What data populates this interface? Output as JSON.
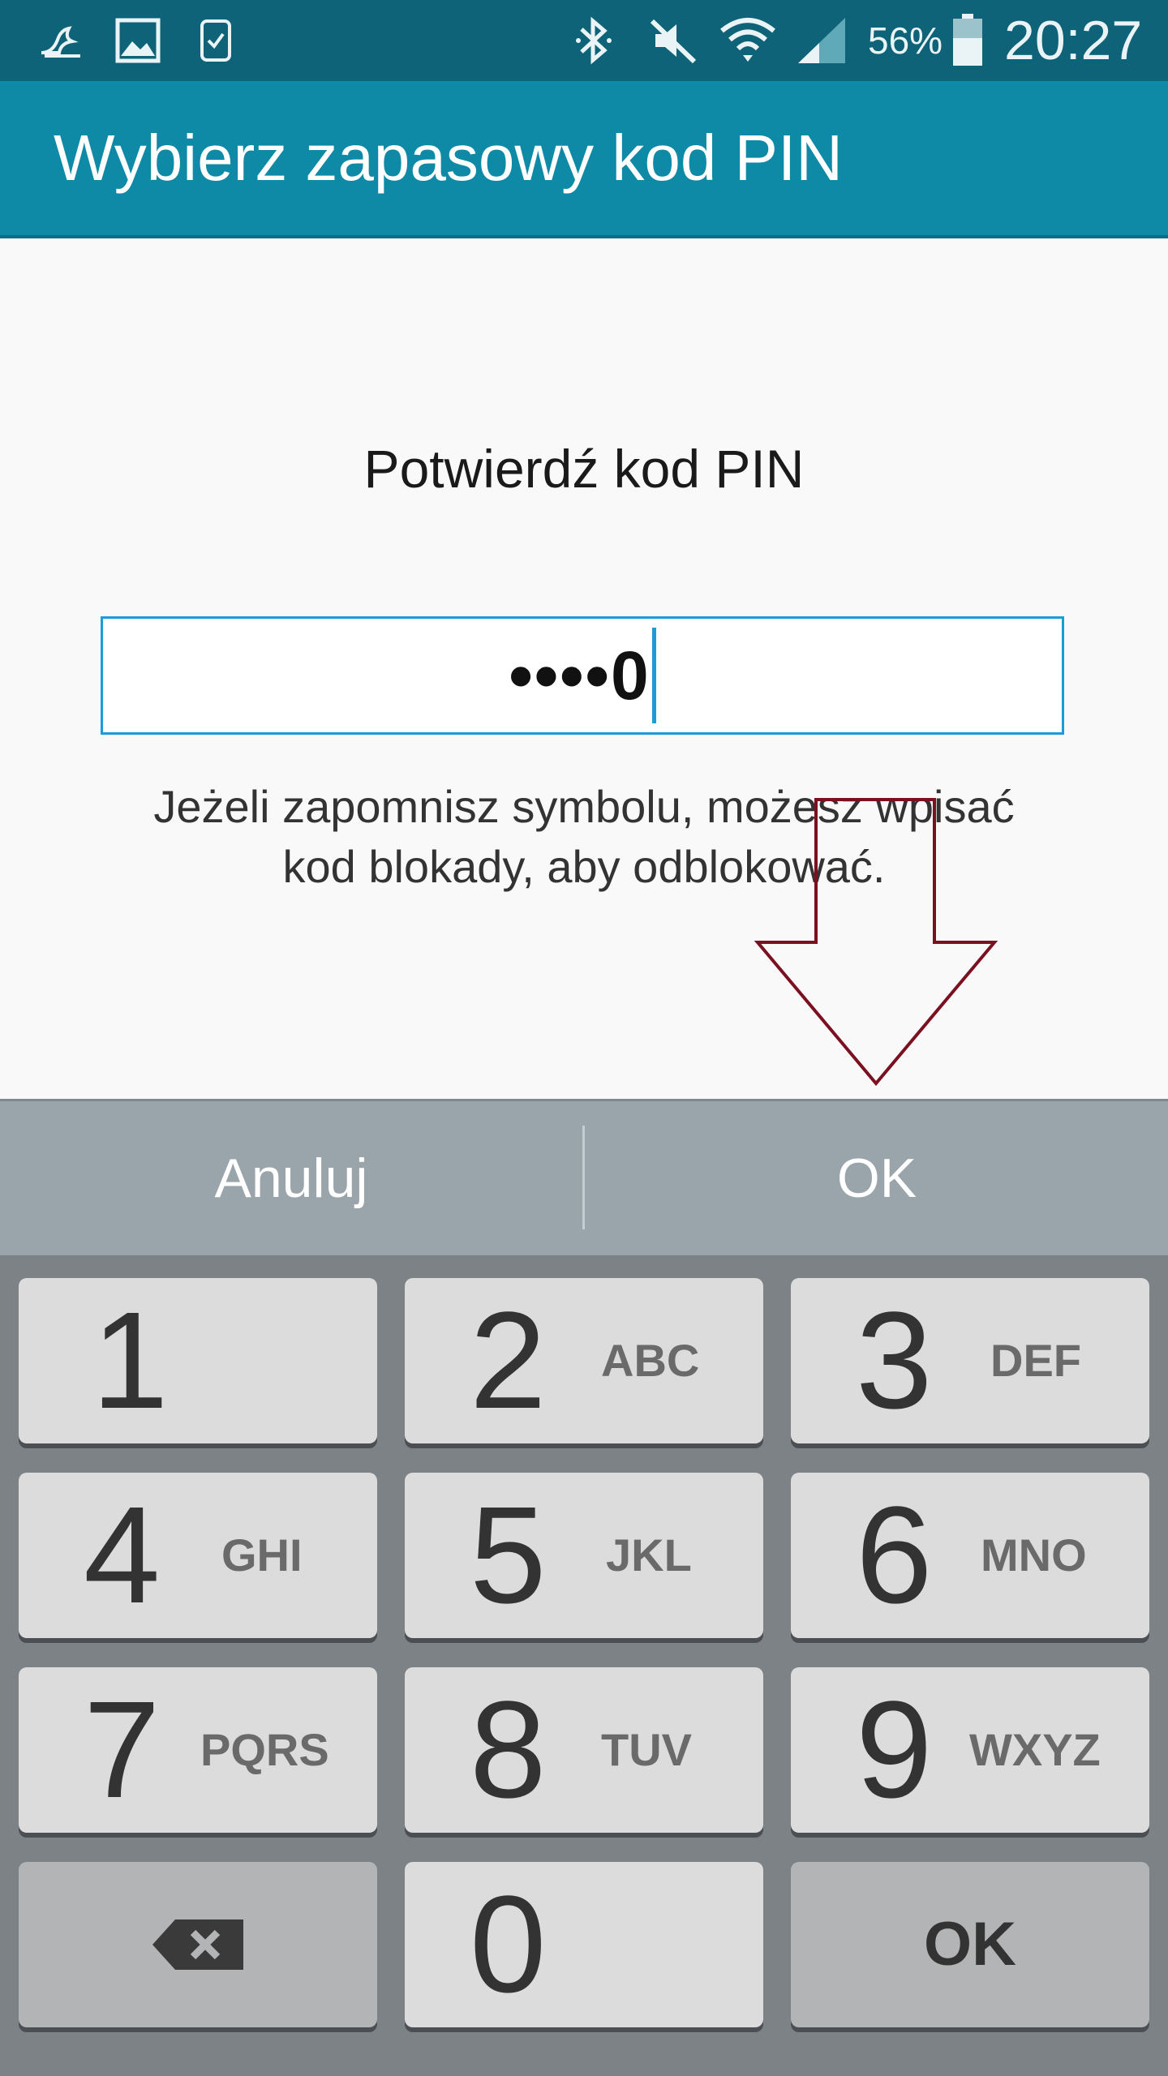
{
  "status_bar": {
    "battery_percent": "56%",
    "time": "20:27",
    "icons": [
      "swiftkey-icon",
      "gallery-icon",
      "watch-icon",
      "bluetooth-icon",
      "mute-icon",
      "wifi-icon",
      "signal-icon",
      "battery-icon"
    ]
  },
  "action_bar": {
    "title": "Wybierz zapasowy kod PIN"
  },
  "content": {
    "prompt": "Potwierdź kod PIN",
    "pin_field": {
      "value": "••••0"
    },
    "hint_line1": "Jeżeli zapomnisz symbolu, możesz wpisać",
    "hint_line2": "kod blokady, aby odblokować."
  },
  "button_bar": {
    "cancel_label": "Anuluj",
    "ok_label": "OK"
  },
  "keypad": {
    "keys": [
      {
        "digit": "1",
        "letters": ""
      },
      {
        "digit": "2",
        "letters": "ABC"
      },
      {
        "digit": "3",
        "letters": "DEF"
      },
      {
        "digit": "4",
        "letters": "GHI"
      },
      {
        "digit": "5",
        "letters": "JKL"
      },
      {
        "digit": "6",
        "letters": "MNO"
      },
      {
        "digit": "7",
        "letters": "PQRS"
      },
      {
        "digit": "8",
        "letters": "TUV"
      },
      {
        "digit": "9",
        "letters": "WXYZ"
      },
      {
        "digit": "0",
        "letters": ""
      }
    ],
    "ok_label": "OK"
  },
  "colors": {
    "status_bar": "#0f6378",
    "action_bar": "#0f8aa6",
    "accent": "#1e9bd6",
    "annotation_arrow": "#7a1020"
  }
}
